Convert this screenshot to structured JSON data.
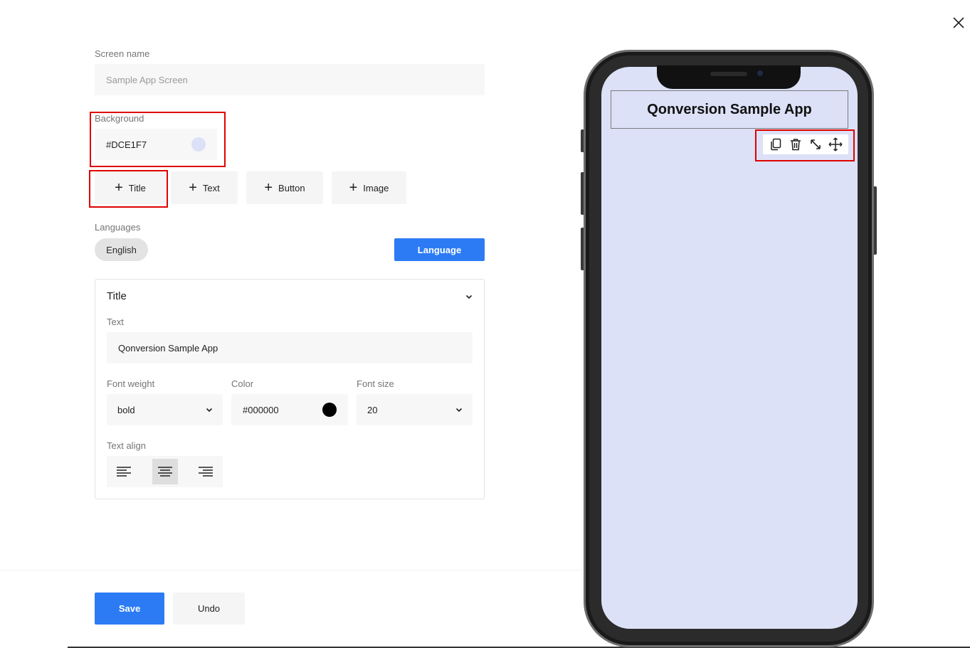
{
  "screen_name": {
    "label": "Screen name",
    "placeholder": "Sample App Screen"
  },
  "background": {
    "label": "Background",
    "value": "#DCE1F7",
    "swatch_color": "#DCE1F7"
  },
  "add_buttons": [
    {
      "label": "Title",
      "icon": "plus-icon"
    },
    {
      "label": "Text",
      "icon": "plus-icon"
    },
    {
      "label": "Button",
      "icon": "plus-icon"
    },
    {
      "label": "Image",
      "icon": "plus-icon"
    }
  ],
  "languages": {
    "label": "Languages",
    "selected": "English",
    "button_label": "Language"
  },
  "title_panel": {
    "header": "Title",
    "text_label": "Text",
    "text_value": "Qonversion Sample App",
    "font_weight_label": "Font weight",
    "font_weight_value": "bold",
    "color_label": "Color",
    "color_value": "#000000",
    "color_swatch": "#000000",
    "font_size_label": "Font size",
    "font_size_value": "20",
    "text_align_label": "Text align",
    "text_align_selected": "center"
  },
  "actions": {
    "save_label": "Save",
    "undo_label": "Undo"
  },
  "preview": {
    "title_text": "Qonversion Sample App",
    "screen_bg": "#DCE1F7",
    "toolbar_icons": [
      "copy-icon",
      "trash-icon",
      "resize-icon",
      "move-icon"
    ]
  },
  "colors": {
    "accent": "#2C7BF4",
    "highlight": "#E00000"
  }
}
